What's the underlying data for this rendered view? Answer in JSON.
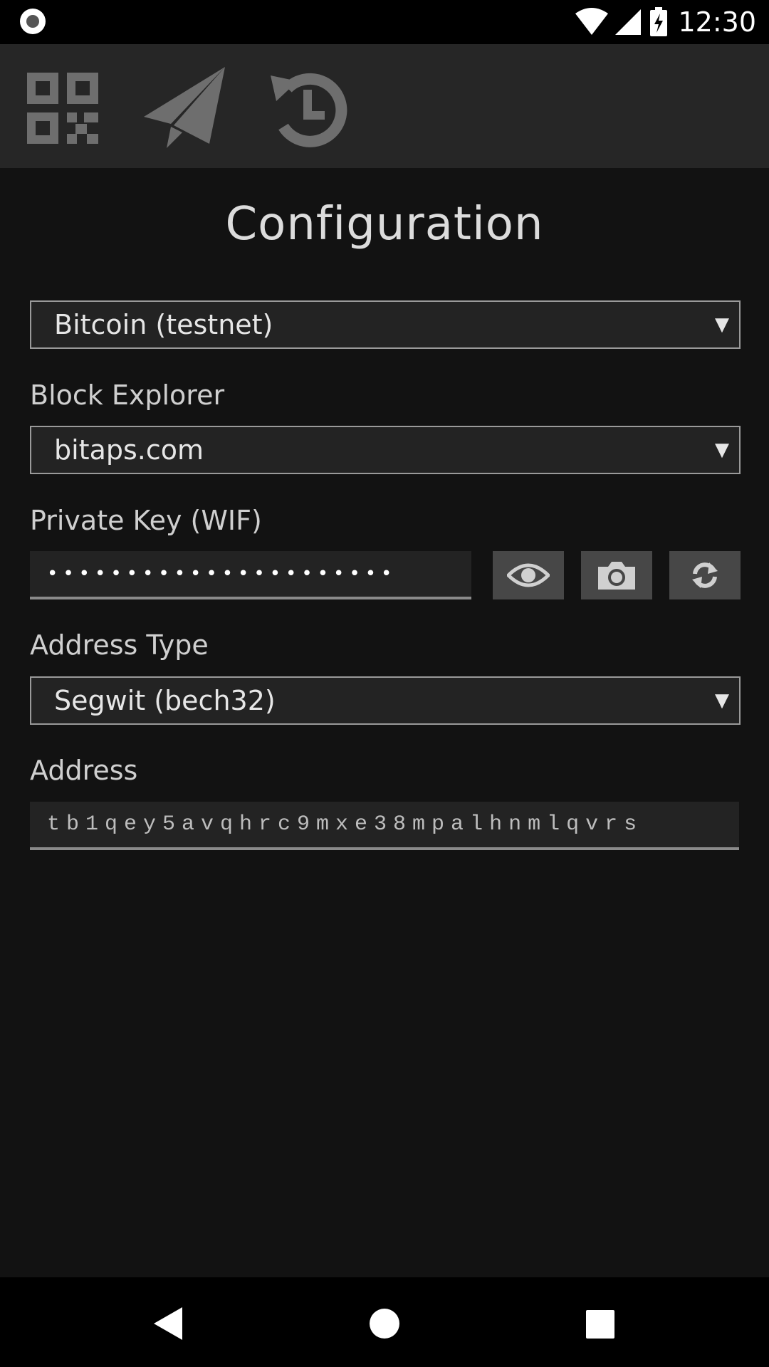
{
  "status_bar": {
    "time": "12:30"
  },
  "toolbar": {
    "items": [
      {
        "icon": "qr-code-icon"
      },
      {
        "icon": "paper-plane-icon"
      },
      {
        "icon": "history-icon"
      }
    ]
  },
  "page": {
    "title": "Configuration"
  },
  "network": {
    "selected": "Bitcoin (testnet)"
  },
  "block_explorer": {
    "label": "Block Explorer",
    "selected": "bitaps.com"
  },
  "private_key": {
    "label": "Private Key (WIF)",
    "masked_value": "••••••••••••••••••••••",
    "buttons": [
      "eye-icon",
      "camera-icon",
      "refresh-icon"
    ]
  },
  "address_type": {
    "label": "Address Type",
    "selected": "Segwit (bech32)"
  },
  "address": {
    "label": "Address",
    "value": "tb1qey5avqhrc9mxe38mpalhnmlqvrs"
  },
  "colors": {
    "background": "#121212",
    "toolbar": "#262626",
    "button": "#474747",
    "icon": "#6e6e6e"
  }
}
